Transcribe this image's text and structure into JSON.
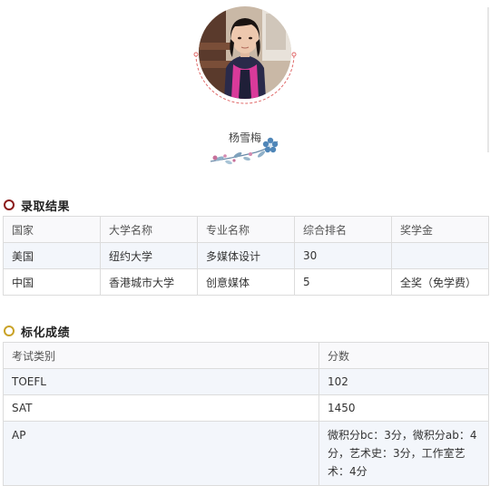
{
  "profile": {
    "name": "杨雪梅"
  },
  "admission": {
    "title": "录取结果",
    "columns": [
      "国家",
      "大学名称",
      "专业名称",
      "综合排名",
      "奖学金"
    ],
    "rows": [
      [
        "美国",
        "纽约大学",
        "多媒体设计",
        "30",
        ""
      ],
      [
        "中国",
        "香港城市大学",
        "创意媒体",
        "5",
        "全奖（免学费）"
      ]
    ]
  },
  "scores": {
    "title": "标化成绩",
    "columns": [
      "考试类别",
      "分数"
    ],
    "rows": [
      [
        "TOEFL",
        "102"
      ],
      [
        "SAT",
        "1450"
      ],
      [
        "AP",
        "微积分bc：3分，微积分ab：4分，艺术史：3分，工作室艺术：4分"
      ]
    ]
  },
  "colors": {
    "admission_marker": "#8b1a1a",
    "scores_marker": "#c9a227",
    "header_bg": "#f9f9fb",
    "alt_row_bg": "#f3f6fb",
    "border": "#dcdcdc"
  }
}
